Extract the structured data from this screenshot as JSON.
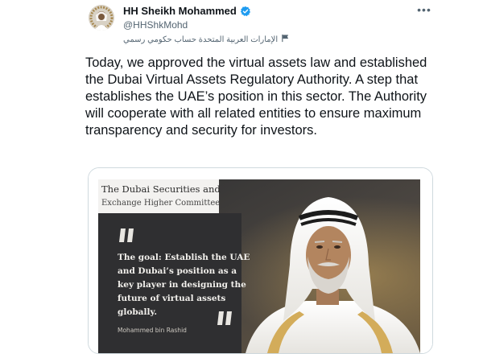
{
  "tweet": {
    "author": {
      "display_name": "HH Sheikh Mohammed",
      "handle": "@HHShkMohd",
      "affiliation": "الإمارات العربية المتحدة حساب حكومي رسمي",
      "verified": true,
      "verified_icon": "verified-badge-icon",
      "affiliation_icon": "flag-icon"
    },
    "more_icon": "more-horizontal-icon",
    "more_label": "•••",
    "text": "Today, we approved the virtual assets law and established the Dubai Virtual Assets Regulatory Authority. A step that establishes the UAE’s position in this sector. The Authority will cooperate with all related entities to ensure maximum transparency and security for investors.",
    "media": {
      "header_line1": "The Dubai Securities and",
      "header_line2": "Exchange Higher Committee",
      "quote_line1": "The goal: Establish the UAE",
      "quote_line2": "and Dubai’s position as a",
      "quote_line3": "key player in designing the",
      "quote_line4": "future of virtual assets",
      "quote_line5": "globally.",
      "attribution": "Mohammed bin Rashid"
    }
  },
  "colors": {
    "verified": "#1d9bf0",
    "secondary_text": "#536471",
    "media_panel": "#2f2f31",
    "media_header_bg": "#f3f2f0",
    "quote_mark": "#e8e6e1"
  }
}
